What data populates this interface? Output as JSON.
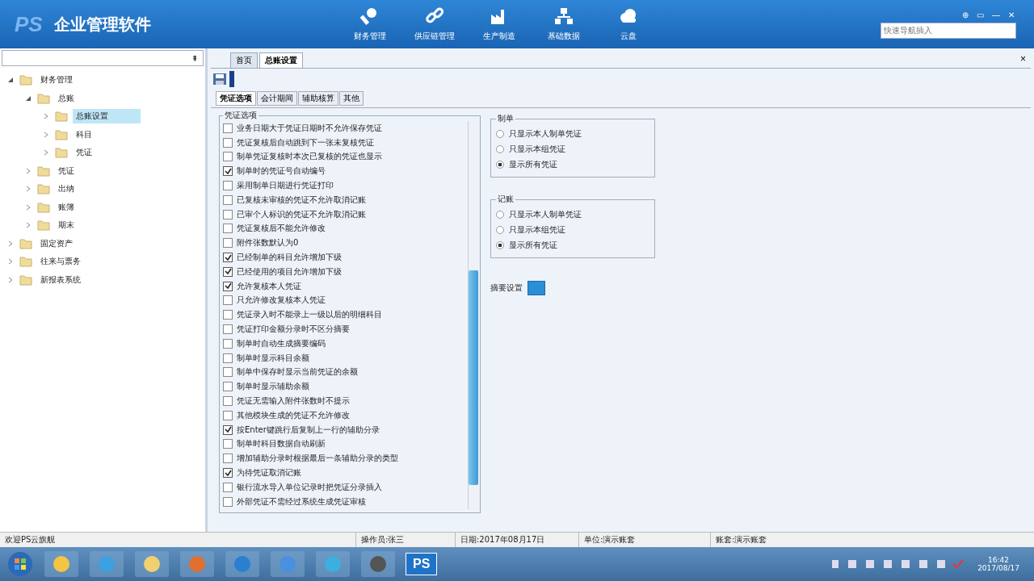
{
  "app": {
    "logo": "PS",
    "title": "企业管理软件",
    "window_buttons": [
      "⊕",
      "▭",
      "—",
      "✕"
    ]
  },
  "nav": [
    {
      "label": "财务管理"
    },
    {
      "label": "供应链管理"
    },
    {
      "label": "生产制造"
    },
    {
      "label": "基础数据"
    },
    {
      "label": "云盘"
    }
  ],
  "search": {
    "placeholder": "快速导航插入"
  },
  "sidebar": {
    "pin": "⇞",
    "tree": [
      {
        "label": "财务管理",
        "expanded": true,
        "selected": false,
        "children": [
          {
            "label": "总账",
            "expanded": true,
            "selected": false,
            "children": [
              {
                "label": "总账设置",
                "expanded": false,
                "selected": true
              },
              {
                "label": "科目",
                "expanded": false,
                "selected": false
              },
              {
                "label": "凭证",
                "expanded": false,
                "selected": false
              }
            ]
          },
          {
            "label": "凭证",
            "expanded": false,
            "selected": false
          },
          {
            "label": "出纳",
            "expanded": false,
            "selected": false
          },
          {
            "label": "账簿",
            "expanded": false,
            "selected": false
          },
          {
            "label": "期末",
            "expanded": false,
            "selected": false
          }
        ]
      },
      {
        "label": "固定资产",
        "expanded": false,
        "selected": false
      },
      {
        "label": "往来与票务",
        "expanded": false,
        "selected": false
      },
      {
        "label": "新报表系统",
        "expanded": false,
        "selected": false
      }
    ]
  },
  "tabs": [
    {
      "label": "首页",
      "selected": false
    },
    {
      "label": "总账设置",
      "selected": true
    }
  ],
  "close_tab": "×",
  "subtabs": [
    {
      "label": "凭证选项",
      "selected": true
    },
    {
      "label": "会计期间",
      "selected": false
    },
    {
      "label": "辅助核算",
      "selected": false
    },
    {
      "label": "其他",
      "selected": false
    }
  ],
  "options": {
    "title": "凭证选项",
    "items": [
      {
        "label": "业务日期大于凭证日期时不允许保存凭证",
        "checked": false
      },
      {
        "label": "凭证复核后自动跳到下一张未复核凭证",
        "checked": false
      },
      {
        "label": "制单凭证复核时本次已复核的凭证也显示",
        "checked": false
      },
      {
        "label": "制单时的凭证号自动编号",
        "checked": true
      },
      {
        "label": "采用制单日期进行凭证打印",
        "checked": false
      },
      {
        "label": "已复核未审核的凭证不允许取消记账",
        "checked": false
      },
      {
        "label": "已审个人标识的凭证不允许取消记账",
        "checked": false
      },
      {
        "label": "凭证复核后不能允许修改",
        "checked": false
      },
      {
        "label": "附件张数默认为0",
        "checked": false
      },
      {
        "label": "已经制单的科目允许增加下级",
        "checked": true
      },
      {
        "label": "已经使用的项目允许增加下级",
        "checked": true
      },
      {
        "label": "允许复核本人凭证",
        "checked": true
      },
      {
        "label": "只允许修改复核本人凭证",
        "checked": false
      },
      {
        "label": "凭证录入时不能录上一级以后的明细科目",
        "checked": false
      },
      {
        "label": "凭证打印金额分录时不区分摘要",
        "checked": false
      },
      {
        "label": "制单时自动生成摘要编码",
        "checked": false
      },
      {
        "label": "制单时显示科目余额",
        "checked": false
      },
      {
        "label": "制单中保存时显示当前凭证的余额",
        "checked": false
      },
      {
        "label": "制单时显示辅助余额",
        "checked": false
      },
      {
        "label": "凭证无需输入附件张数时不提示",
        "checked": false
      },
      {
        "label": "其他模块生成的凭证不允许修改",
        "checked": false
      },
      {
        "label": "按Enter键跳行后复制上一行的辅助分录",
        "checked": true
      },
      {
        "label": "制单时科目数据自动刷新",
        "checked": false
      },
      {
        "label": "增加辅助分录时根据最后一条辅助分录的类型",
        "checked": false
      },
      {
        "label": "为待凭证取消记账",
        "checked": true
      },
      {
        "label": "银行流水导入单位记录时把凭证分录插入",
        "checked": false
      },
      {
        "label": "外部凭证不需经过系统生成凭证审核",
        "checked": false
      }
    ]
  },
  "groups": [
    {
      "title": "制单",
      "options": [
        {
          "label": "只显示本人制单凭证",
          "selected": false
        },
        {
          "label": "只显示本组凭证",
          "selected": false
        },
        {
          "label": "显示所有凭证",
          "selected": true
        }
      ]
    },
    {
      "title": "记账",
      "options": [
        {
          "label": "只显示本人制单凭证",
          "selected": false
        },
        {
          "label": "只显示本组凭证",
          "selected": false
        },
        {
          "label": "显示所有凭证",
          "selected": true
        }
      ]
    }
  ],
  "summary_setting": {
    "label": "摘要设置"
  },
  "status_bar": [
    "欢迎PS云旗舰",
    "操作员:张三",
    "日期:2017年08月17日",
    "单位:演示账套",
    "账套:演示账套"
  ],
  "taskbar": {
    "time": "16:42",
    "date": "2017/08/17",
    "ps_label": "PS"
  }
}
